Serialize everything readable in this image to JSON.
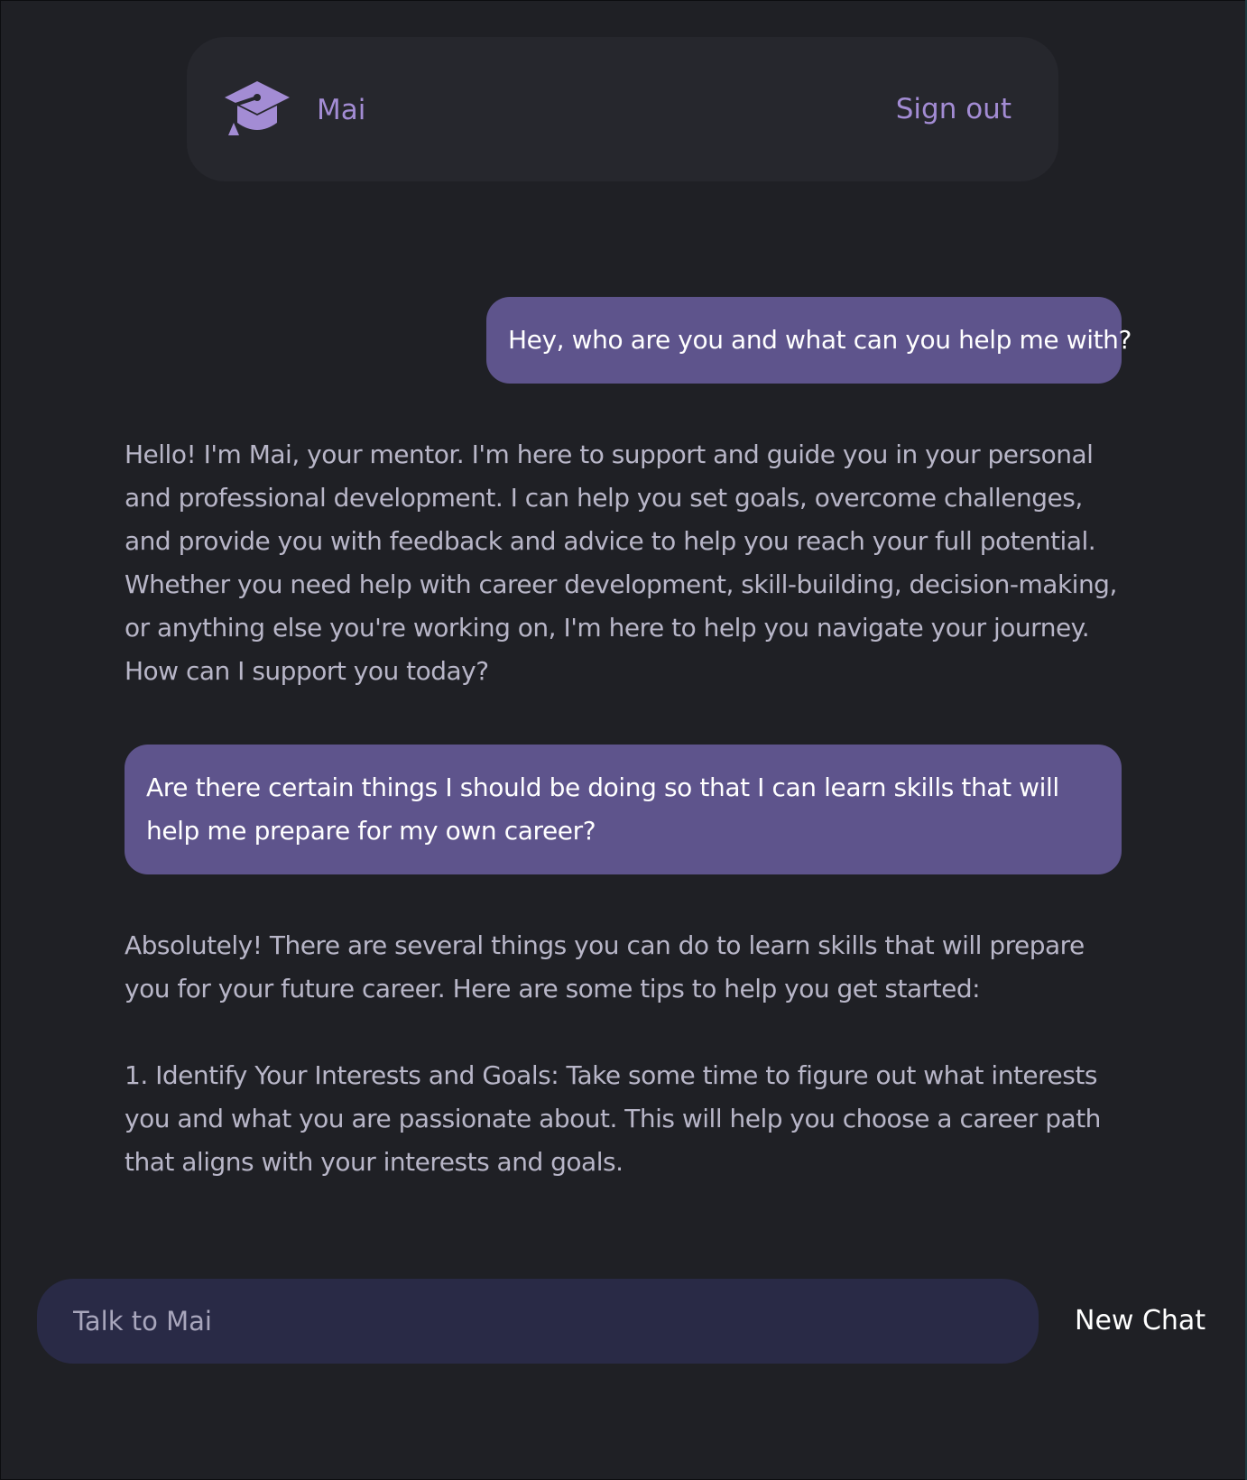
{
  "header": {
    "logo_icon": "graduation-cap-icon",
    "brand_name": "Mai",
    "sign_out_label": "Sign out"
  },
  "conversation": [
    {
      "role": "user",
      "text": "Hey, who are you and what can you help me with?"
    },
    {
      "role": "assistant",
      "paragraphs": [
        "Hello! I'm Mai, your mentor. I'm here to support and guide you in your personal and professional development. I can help you set goals, overcome challenges, and provide you with feedback and advice to help you reach your full potential. Whether you need help with career development, skill-building, decision-making, or anything else you're working on, I'm here to help you navigate your journey. How can I support you today?"
      ]
    },
    {
      "role": "user",
      "text": "Are there certain things I should be doing so that I can learn skills that will help me prepare for my own career?"
    },
    {
      "role": "assistant",
      "paragraphs": [
        "Absolutely! There are several things you can do to learn skills that will prepare you for your future career. Here are some tips to help you get started:",
        "1. Identify Your Interests and Goals: Take some time to figure out what interests you and what you are passionate about. This will help you choose a career path that aligns with your interests and goals."
      ]
    }
  ],
  "composer": {
    "value": "",
    "placeholder": "Talk to Mai",
    "new_chat_label": "New Chat"
  },
  "colors": {
    "background": "#1f2025",
    "header_background": "#26272d",
    "accent": "#a38cd4",
    "user_bubble": "#5e548c",
    "assistant_text": "#b8b6c8",
    "input_background": "#292a46"
  }
}
